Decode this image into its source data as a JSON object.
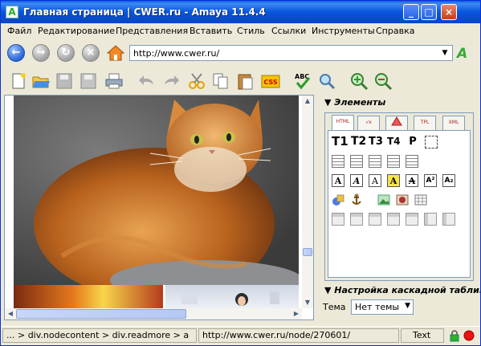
{
  "window": {
    "title": "Главная страница | CWER.ru - Amaya 11.4.4"
  },
  "menu": [
    "Файл",
    "Редактирование",
    "Представления",
    "Вставить",
    "Стиль",
    "Ссылки",
    "Инструменты",
    "Справка"
  ],
  "address": {
    "url": "http://www.cwer.ru/"
  },
  "panel": {
    "elements_title": "Элементы",
    "tabs": [
      "HTML",
      "√x",
      "",
      "TPL",
      "XML"
    ],
    "heading_buttons": [
      "T1",
      "T2",
      "T3",
      "T4",
      "P"
    ],
    "style_title": "Настройка каскадной таблиц",
    "theme_label": "Тема",
    "theme_value": "Нет темы"
  },
  "statusbar": {
    "path": "... > div.nodecontent > div.readmore > a",
    "link": "http://www.cwer.ru/node/270601/",
    "mode": "Text"
  },
  "colors": {
    "titlebar": "#0855dd",
    "accent_green": "#33aa33"
  }
}
